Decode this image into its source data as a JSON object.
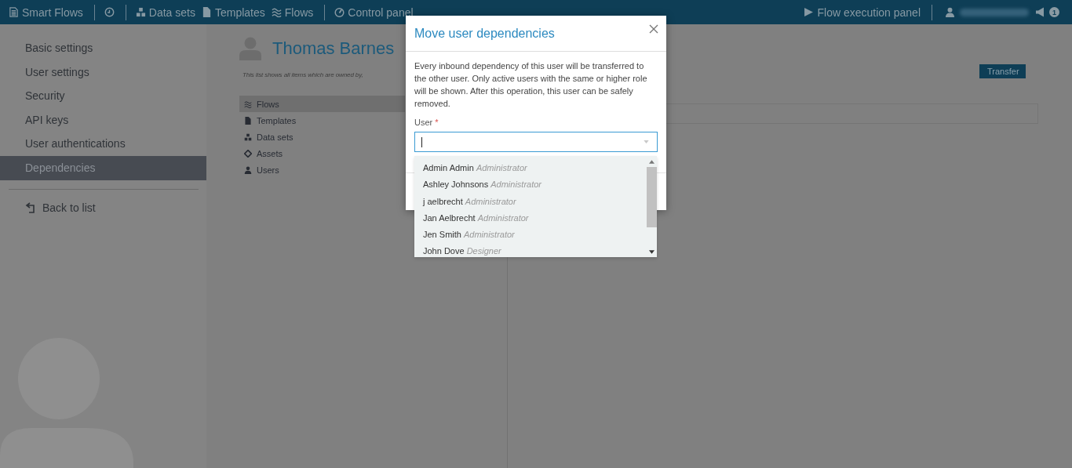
{
  "topbar": {
    "brand": "Smart Flows",
    "nav": [
      {
        "kind": "history"
      },
      {
        "kind": "datasets",
        "label": "Data sets"
      },
      {
        "kind": "templates",
        "label": "Templates"
      },
      {
        "kind": "flows",
        "label": "Flows"
      },
      {
        "kind": "control",
        "label": "Control panel"
      }
    ],
    "execution_panel": "Flow execution panel",
    "notification_count": "1"
  },
  "sidebar": {
    "items": [
      {
        "label": "Basic settings",
        "selected": false
      },
      {
        "label": "User settings",
        "selected": false
      },
      {
        "label": "Security",
        "selected": false
      },
      {
        "label": "API keys",
        "selected": false
      },
      {
        "label": "User authentications",
        "selected": false
      },
      {
        "label": "Dependencies",
        "selected": true
      }
    ],
    "back": "Back to list"
  },
  "main": {
    "title": "Thomas Barnes",
    "note": "This list shows all items which are owned by,",
    "categories": [
      {
        "kind": "flows",
        "label": "Flows",
        "selected": true
      },
      {
        "kind": "templates",
        "label": "Templates",
        "selected": false
      },
      {
        "kind": "datasets",
        "label": "Data sets",
        "selected": false
      },
      {
        "kind": "assets",
        "label": "Assets",
        "selected": false
      },
      {
        "kind": "users",
        "label": "Users",
        "selected": false
      }
    ],
    "transfer_button": "Transfer"
  },
  "modal": {
    "title": "Move user dependencies",
    "description": "Every inbound dependency of this user will be transferred to the other user. Only active users with the same or higher role will be shown. After this operation, this user can be safely removed.",
    "field_label": "User",
    "required_mark": "*",
    "options": [
      {
        "name": "Admin Admin",
        "role": "Administrator"
      },
      {
        "name": "Ashley Johnsons",
        "role": "Administrator"
      },
      {
        "name": "j aelbrecht",
        "role": "Administrator"
      },
      {
        "name": "Jan Aelbrecht",
        "role": "Administrator"
      },
      {
        "name": "Jen Smith",
        "role": "Administrator"
      },
      {
        "name": "John Dove",
        "role": "Designer"
      }
    ]
  }
}
